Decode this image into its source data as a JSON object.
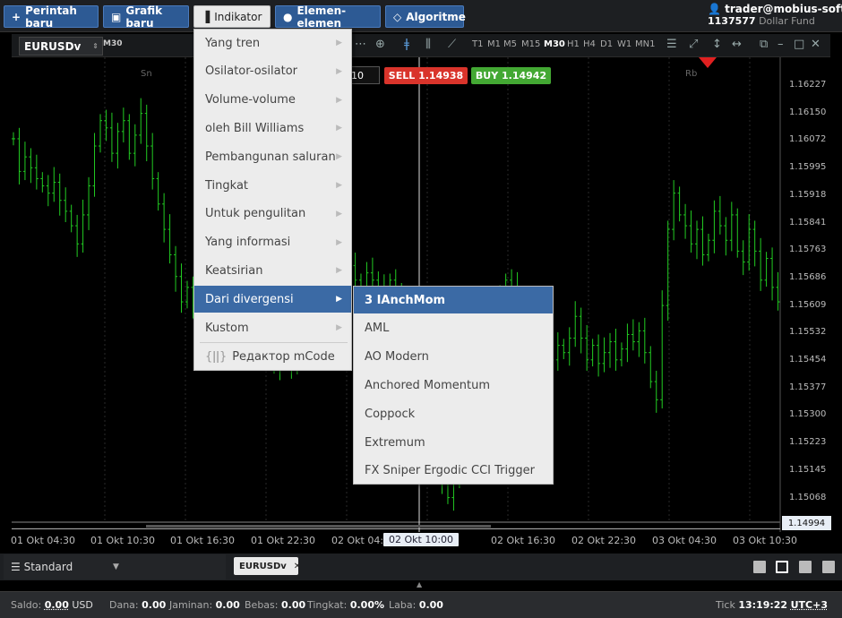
{
  "toolbar": {
    "new_order": "Perintah baru",
    "new_chart": "Grafik baru",
    "indicator": "Indikator",
    "elements": "Elemen-elemen",
    "algorithm": "Algoritme"
  },
  "user": {
    "email": "trader@mobius-soft.org",
    "account": "1137577",
    "fund": "Dollar Fund"
  },
  "chart_toolbar": {
    "symbol": "EURUSDv",
    "timeframe_badge": "M30",
    "timeframes": [
      "T1",
      "M1",
      "M5",
      "M15",
      "M30",
      "H1",
      "H4",
      "D1",
      "W1",
      "MN1"
    ],
    "selected_timeframe": "M30",
    "lot": "10"
  },
  "trade": {
    "sell_label": "SELL",
    "sell_price": "1.14938",
    "buy_label": "BUY",
    "buy_price": "1.14942"
  },
  "chart_data": {
    "type": "candlestick",
    "symbol": "EURUSDv",
    "y_ticks": [
      "1.16227",
      "1.16150",
      "1.16072",
      "1.15995",
      "1.15918",
      "1.15841",
      "1.15763",
      "1.15686",
      "1.15609",
      "1.15532",
      "1.15454",
      "1.15377",
      "1.15300",
      "1.15223",
      "1.15145",
      "1.15068"
    ],
    "ylim": [
      1.1499,
      1.1627
    ],
    "current_price": "1.14994",
    "x_ticks": [
      "01 Okt 04:30",
      "01 Okt 10:30",
      "01 Okt 16:30",
      "01 Okt 22:30",
      "02 Okt 04:30",
      "02 Okt 10:00",
      "02 Okt 16:30",
      "02 Okt 22:30",
      "03 Okt 04:30",
      "03 Okt 10:30"
    ],
    "crosshair_x_label": "02 Okt 10:00",
    "session_labels": [
      "Sn",
      "Rb"
    ],
    "series_color": "#22cc22",
    "closes": [
      1.1607,
      1.1598,
      1.1602,
      1.1599,
      1.1596,
      1.1594,
      1.1592,
      1.1595,
      1.159,
      1.1587,
      1.1583,
      1.1578,
      1.1586,
      1.1594,
      1.1605,
      1.1612,
      1.161,
      1.1603,
      1.1609,
      1.1612,
      1.1603,
      1.1608,
      1.1614,
      1.1605,
      1.1596,
      1.1589,
      1.1582,
      1.1575,
      1.1569,
      1.1562,
      1.1566,
      1.1561,
      1.1569,
      1.1575,
      1.1573,
      1.1571,
      1.1578,
      1.157,
      1.1562,
      1.1568,
      1.1572,
      1.1567,
      1.1564,
      1.1556,
      1.155,
      1.1544,
      1.1548,
      1.1552,
      1.1545,
      1.1551,
      1.1548,
      1.1556,
      1.1549,
      1.1553,
      1.156,
      1.1566,
      1.1571,
      1.1576,
      1.1572,
      1.1568,
      1.1566,
      1.157,
      1.1568,
      1.1565,
      1.1566,
      1.1568,
      1.1563,
      1.1558,
      1.1552,
      1.1546,
      1.154,
      1.1534,
      1.1525,
      1.1518,
      1.1512,
      1.1508,
      1.1513,
      1.1518,
      1.1525,
      1.1532,
      1.154,
      1.1547,
      1.1553,
      1.1558,
      1.1563,
      1.1568,
      1.1566,
      1.1559,
      1.1552,
      1.1546,
      1.1542,
      1.1538,
      1.1542,
      1.1546,
      1.155,
      1.1548,
      1.1552,
      1.1558,
      1.1552,
      1.1546,
      1.155,
      1.1545,
      1.1548,
      1.1551,
      1.1546,
      1.1549,
      1.1553,
      1.1551,
      1.1554,
      1.1548,
      1.154,
      1.1535,
      1.1561,
      1.1582,
      1.1592,
      1.1586,
      1.1583,
      1.1578,
      1.1582,
      1.1575,
      1.1579,
      1.1587,
      1.1583,
      1.1579,
      1.1586,
      1.1576,
      1.1573,
      1.1582,
      1.1576,
      1.1568,
      1.1574,
      1.1566,
      1.1562
    ]
  },
  "menu": {
    "items": [
      {
        "label": "Yang tren"
      },
      {
        "label": "Osilator-osilator"
      },
      {
        "label": "Volume-volume"
      },
      {
        "label": "oleh Bill Williams"
      },
      {
        "label": "Pembangunan saluran"
      },
      {
        "label": "Tingkat"
      },
      {
        "label": "Untuk pengulitan"
      },
      {
        "label": "Yang informasi"
      },
      {
        "label": "Keatsirian"
      },
      {
        "label": "Dari divergensi"
      },
      {
        "label": "Kustom"
      }
    ],
    "editor": "Редактор mCode",
    "selected": "Dari divergensi"
  },
  "submenu": {
    "items": [
      "3 IAnchMom",
      "AML",
      "AO Modern",
      "Anchored Momentum",
      "Coppock",
      "Extremum",
      "FX Sniper Ergodic CCI Trigger"
    ],
    "selected": "3 IAnchMom"
  },
  "bottom": {
    "layout_name": "Standard",
    "chart_tab": "EURUSDv"
  },
  "status": {
    "saldo_label": "Saldo:",
    "saldo_value": "0.00",
    "saldo_ccy": "USD",
    "dana_label": "Dana:",
    "dana_value": "0.00",
    "jaminan_label": "Jaminan:",
    "jaminan_value": "0.00",
    "bebas_label": "Bebas:",
    "bebas_value": "0.00",
    "tingkat_label": "Tingkat:",
    "tingkat_value": "0.00%",
    "laba_label": "Laba:",
    "laba_value": "0.00",
    "tick_label": "Tick",
    "time": "13:19:22",
    "tz": "UTC+3"
  }
}
